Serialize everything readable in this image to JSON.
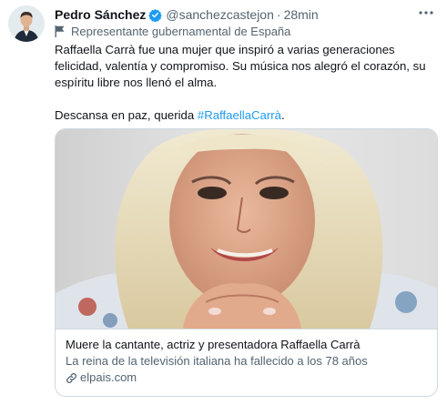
{
  "author": {
    "display_name": "Pedro Sánchez",
    "handle": "@sanchezcastejon",
    "separator": "·",
    "time": "28min",
    "verified": true
  },
  "affiliation": {
    "label": "Representante gubernamental de España",
    "icon": "flag-icon"
  },
  "tweet": {
    "line1": "Raffaella Carrà fue una mujer que inspiró a varias generaciones felicidad, valentía y compromiso. Su música nos alegró el corazón, su espíritu libre nos llenó el alma.",
    "line2_prefix": "Descansa en paz, querida ",
    "hashtag": "#RaffaellaCarrà",
    "line2_suffix": "."
  },
  "card": {
    "title": "Muere la cantante, actriz y presentadora Raffaella Carrà",
    "description": "La reina de la televisión italiana ha fallecido a los 78 años",
    "domain": "elpais.com",
    "link_icon": "link-icon"
  },
  "colors": {
    "accent": "#1d9bf0",
    "secondary_text": "#536471",
    "border": "#cfd9de"
  }
}
